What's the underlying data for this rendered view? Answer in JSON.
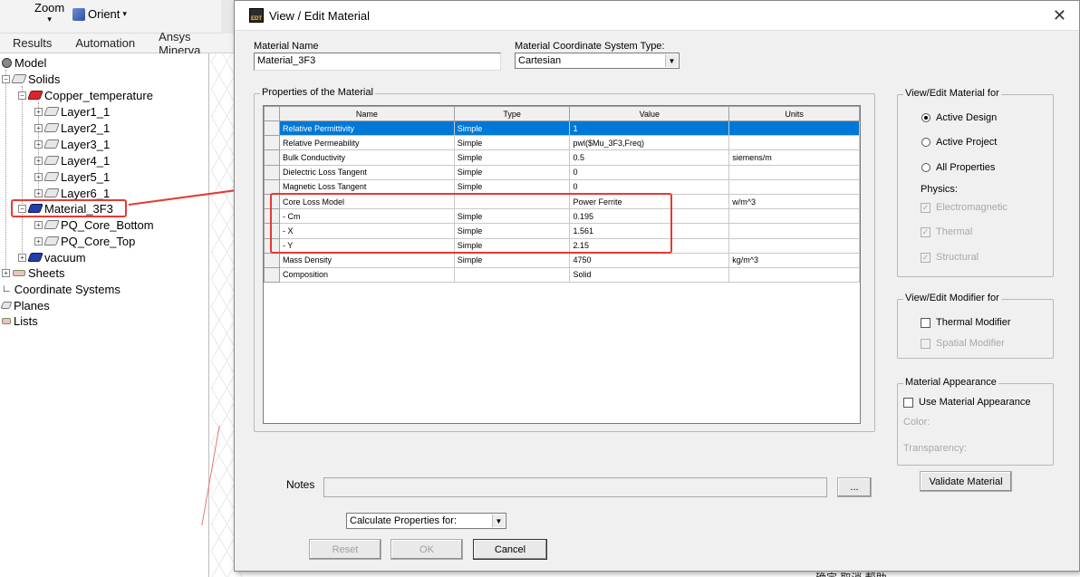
{
  "app": {
    "toolbar": {
      "zoom_label": "Zoom",
      "orient_label": "Orient"
    },
    "tabs": [
      "Results",
      "Automation",
      "Ansys Minerva"
    ],
    "tree": {
      "model": "Model",
      "solids": "Solids",
      "copper": "Copper_temperature",
      "layers": [
        "Layer1_1",
        "Layer2_1",
        "Layer3_1",
        "Layer4_1",
        "Layer5_1",
        "Layer6_1"
      ],
      "material_3f3": "Material_3F3",
      "pq_bottom": "PQ_Core_Bottom",
      "pq_top": "PQ_Core_Top",
      "vacuum": "vacuum",
      "sheets": "Sheets",
      "coord_systems": "Coordinate Systems",
      "planes": "Planes",
      "lists": "Lists"
    },
    "bottom_text": "确定            取消            帮助"
  },
  "dialog": {
    "title": "View / Edit Material",
    "material_name_label": "Material Name",
    "material_name_value": "Material_3F3",
    "coord_type_label": "Material Coordinate System Type:",
    "coord_type_value": "Cartesian",
    "properties_group": "Properties of the Material",
    "columns": [
      "Name",
      "Type",
      "Value",
      "Units"
    ],
    "rows": [
      {
        "name": "Relative Permittivity",
        "type": "Simple",
        "value": "1",
        "units": ""
      },
      {
        "name": "Relative Permeability",
        "type": "Simple",
        "value": "pwl($Mu_3F3,Freq)",
        "units": ""
      },
      {
        "name": "Bulk Conductivity",
        "type": "Simple",
        "value": "0.5",
        "units": "siemens/m"
      },
      {
        "name": "Dielectric Loss Tangent",
        "type": "Simple",
        "value": "0",
        "units": ""
      },
      {
        "name": "Magnetic Loss Tangent",
        "type": "Simple",
        "value": "0",
        "units": ""
      },
      {
        "name": "Core Loss Model",
        "type": "",
        "value": "Power Ferrite",
        "units": "w/m^3"
      },
      {
        "name": "- Cm",
        "type": "Simple",
        "value": "0.195",
        "units": ""
      },
      {
        "name": "- X",
        "type": "Simple",
        "value": "1.561",
        "units": ""
      },
      {
        "name": "- Y",
        "type": "Simple",
        "value": "2.15",
        "units": ""
      },
      {
        "name": "Mass Density",
        "type": "Simple",
        "value": "4750",
        "units": "kg/m^3"
      },
      {
        "name": "Composition",
        "type": "",
        "value": "Solid",
        "units": ""
      }
    ],
    "view_edit_for": {
      "title": "View/Edit Material for",
      "active_design": "Active Design",
      "active_project": "Active Project",
      "all_properties": "All Properties",
      "physics_label": "Physics:",
      "electromagnetic": "Electromagnetic",
      "thermal": "Thermal",
      "structural": "Structural"
    },
    "modifier_for": {
      "title": "View/Edit Modifier for",
      "thermal_modifier": "Thermal Modifier",
      "spatial_modifier": "Spatial Modifier"
    },
    "appearance": {
      "title": "Material Appearance",
      "use_appearance": "Use Material Appearance",
      "color_label": "Color:",
      "transparency_label": "Transparency:"
    },
    "validate_label": "Validate Material",
    "notes_label": "Notes",
    "notes_value": "",
    "notes_browse": "...",
    "calc_props_value": "Calculate Properties for:",
    "reset_label": "Reset",
    "ok_label": "OK",
    "cancel_label": "Cancel"
  }
}
